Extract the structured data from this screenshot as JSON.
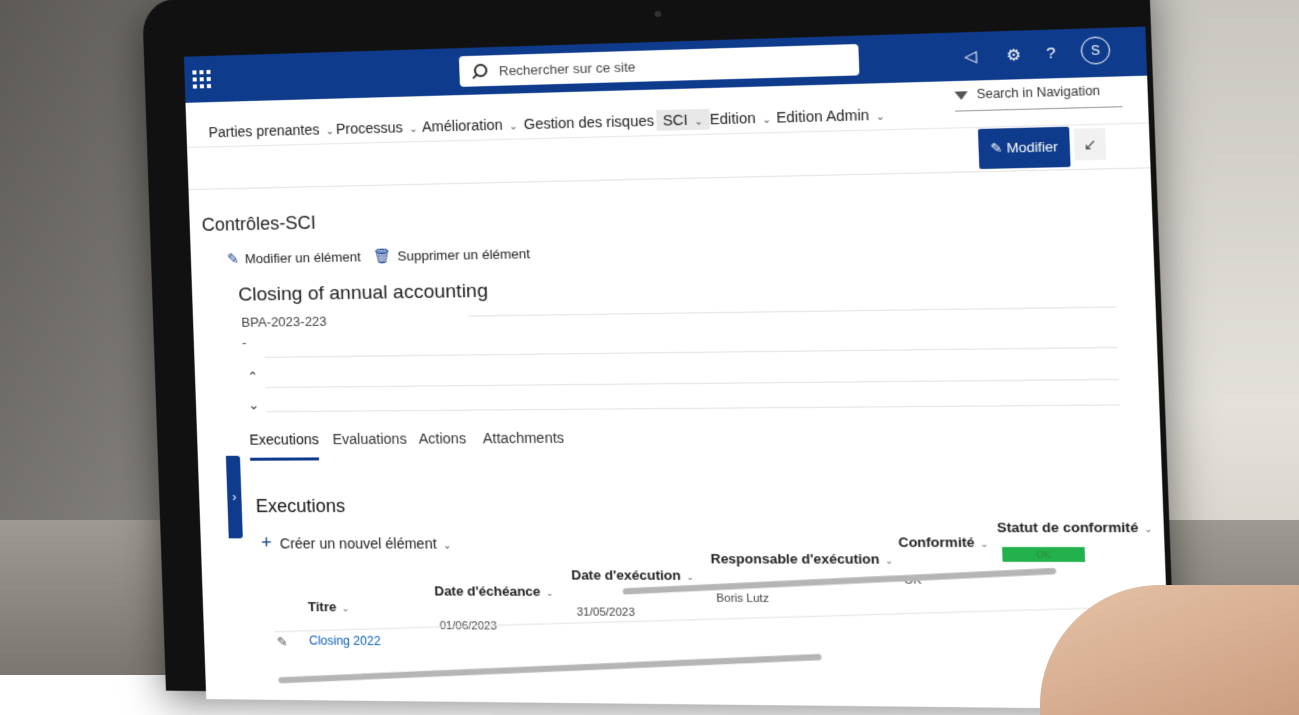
{
  "topbar": {
    "search_placeholder": "Rechercher sur ce site",
    "avatar_initial": "S",
    "icons": [
      "waffle-icon",
      "megaphone-icon",
      "gear-icon",
      "help-icon"
    ],
    "help_glyph": "?"
  },
  "nav": {
    "items": [
      {
        "label": "Parties prenantes"
      },
      {
        "label": "Processus"
      },
      {
        "label": "Amélioration"
      },
      {
        "label": "Gestion des risques"
      },
      {
        "label": "SCI"
      },
      {
        "label": "Edition"
      },
      {
        "label": "Edition Admin"
      }
    ],
    "active": "SCI",
    "search_label": "Search in Navigation",
    "edit_button": "Modifier"
  },
  "list": {
    "title": "Contrôles-SCI",
    "commands": {
      "edit": "Modifier un élément",
      "delete": "Supprimer un élément"
    }
  },
  "item": {
    "title": "Closing of annual accounting",
    "code": "BPA-2023-223",
    "dash": "-"
  },
  "tabs": [
    {
      "label": "Executions"
    },
    {
      "label": "Evaluations"
    },
    {
      "label": "Actions"
    },
    {
      "label": "Attachments"
    }
  ],
  "executions": {
    "section_title": "Executions",
    "new_item": "Créer un nouvel élément",
    "columns": {
      "titre": "Titre",
      "due": "Date d'échéance",
      "exec": "Date d'exécution",
      "resp": "Responsable d'exécution",
      "conf": "Conformité",
      "status": "Statut de conformité"
    },
    "rows": [
      {
        "titre": "Closing 2022",
        "due": "01/06/2023",
        "exec": "31/05/2023",
        "resp": "Boris Lutz",
        "conf": "OK",
        "status": "OK"
      }
    ]
  },
  "colors": {
    "brand": "#0f3b8c",
    "status_ok": "#22b14c",
    "link": "#0f5fb5"
  }
}
